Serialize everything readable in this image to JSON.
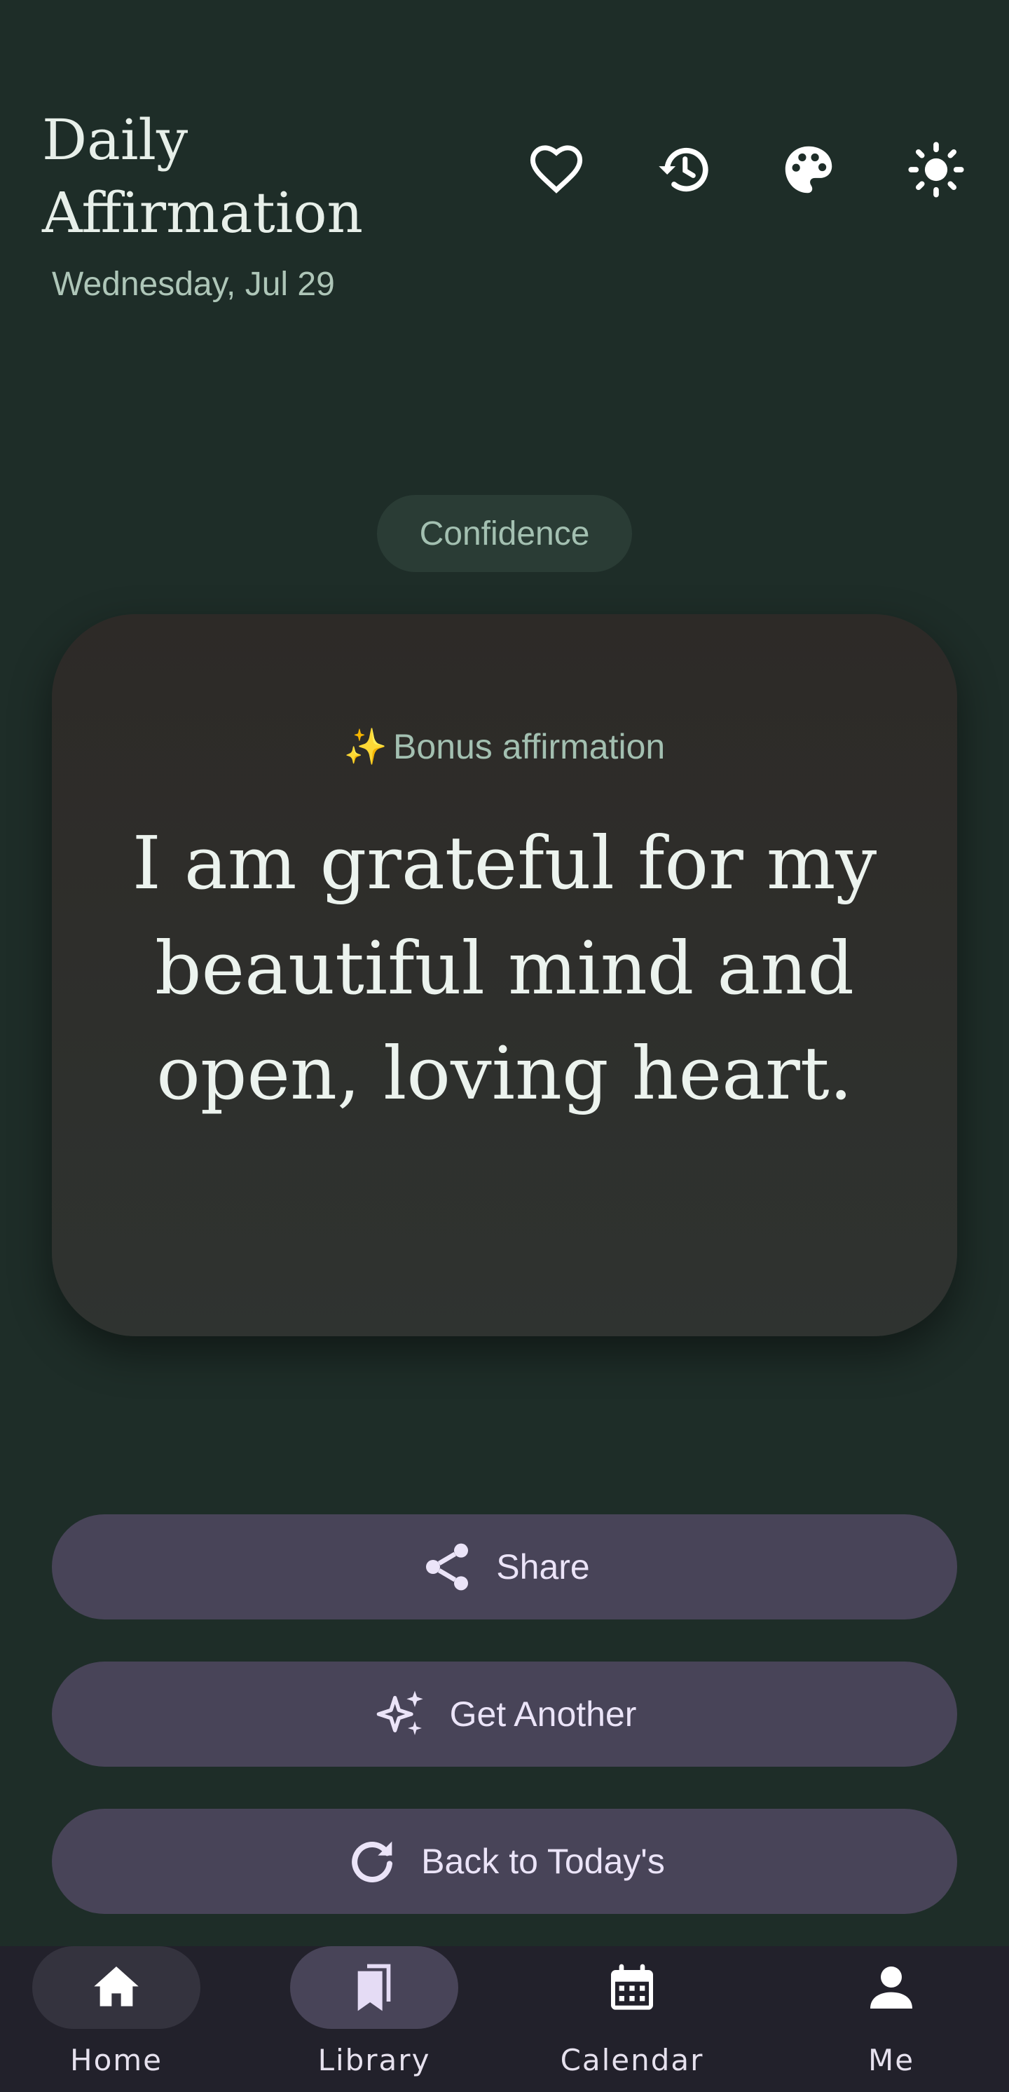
{
  "header": {
    "title": "Daily Affirmation",
    "date": "Wednesday, Jul 29",
    "icons": [
      "heart-icon",
      "history-icon",
      "palette-icon",
      "brightness-icon"
    ]
  },
  "category_chip": "Confidence",
  "card": {
    "bonus_spark": "✨",
    "bonus_label": "Bonus affirmation",
    "affirmation": "I am grateful for my beautiful mind and open, loving heart."
  },
  "actions": {
    "share": "Share",
    "get_another": "Get Another",
    "back_to_today": "Back to Today's"
  },
  "nav": {
    "items": [
      {
        "label": "Home",
        "icon": "home-icon",
        "selected": true
      },
      {
        "label": "Library",
        "icon": "library-icon",
        "selected": false
      },
      {
        "label": "Calendar",
        "icon": "calendar-icon",
        "selected": false
      },
      {
        "label": "Me",
        "icon": "person-icon",
        "selected": false
      }
    ]
  },
  "colors": {
    "background": "#1e2d28",
    "chip_bg": "#2a3c35",
    "button_bg": "#484458",
    "nav_bg": "#22212b",
    "accent_text": "#a3c0b1"
  }
}
